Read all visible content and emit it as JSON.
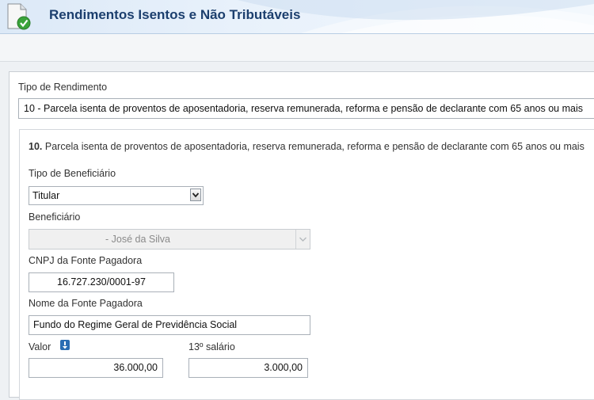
{
  "header": {
    "title": "Rendimentos Isentos e Não Tributáveis",
    "icon": "document-check-icon"
  },
  "form": {
    "tipo_rendimento_label": "Tipo de Rendimento",
    "tipo_rendimento_value": "10 - Parcela isenta de proventos de aposentadoria, reserva remunerada, reforma e pensão de declarante com 65 anos ou mais",
    "section_number": "10.",
    "section_title": "Parcela isenta de proventos de aposentadoria, reserva remunerada, reforma e pensão de declarante com 65 anos ou mais",
    "tipo_beneficiario_label": "Tipo de Beneficiário",
    "tipo_beneficiario_value": "Titular",
    "beneficiario_label": "Beneficiário",
    "beneficiario_value": "- José da Silva",
    "cnpj_label": "CNPJ da Fonte Pagadora",
    "cnpj_value": "16.727.230/0001-97",
    "nome_fonte_label": "Nome da Fonte Pagadora",
    "nome_fonte_value": "Fundo do Regime Geral de Previdência Social",
    "valor_label": "Valor",
    "valor_value": "36.000,00",
    "decimo_label": "13º salário",
    "decimo_value": "3.000,00"
  },
  "colors": {
    "title": "#1c3f6e",
    "accent": "#2a6db3",
    "check": "#3aa33a"
  }
}
